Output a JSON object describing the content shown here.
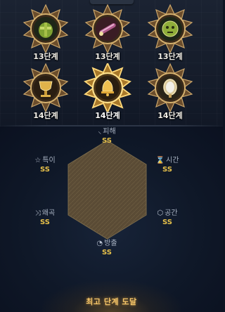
{
  "medals": [
    {
      "level": "13단계",
      "item": "green-helmet-icon",
      "selected": false
    },
    {
      "level": "13단계",
      "item": "purple-blade-icon",
      "selected": false
    },
    {
      "level": "13단계",
      "item": "green-idol-icon",
      "selected": false
    },
    {
      "level": "14단계",
      "item": "golden-chalice-icon",
      "selected": false
    },
    {
      "level": "14단계",
      "item": "golden-bell-icon",
      "selected": true
    },
    {
      "level": "14단계",
      "item": "mirror-icon",
      "selected": false
    }
  ],
  "stats": {
    "damage": {
      "icon": "sword-icon",
      "label": "피해",
      "grade": "SS"
    },
    "time": {
      "icon": "hourglass-icon",
      "label": "시간",
      "grade": "SS"
    },
    "space": {
      "icon": "cube-icon",
      "label": "공간",
      "grade": "SS"
    },
    "defense": {
      "icon": "shield-icon",
      "label": "방출",
      "grade": "SS"
    },
    "distort": {
      "icon": "shuffle-icon",
      "label": "왜곡",
      "grade": "SS"
    },
    "special": {
      "icon": "star-icon",
      "label": "특이",
      "grade": "SS"
    }
  },
  "footer": {
    "status": "최고 단계 도달"
  },
  "colors": {
    "grade": "#e6c04a",
    "gold": "#c9a35a",
    "accent": "#f5c66a"
  }
}
